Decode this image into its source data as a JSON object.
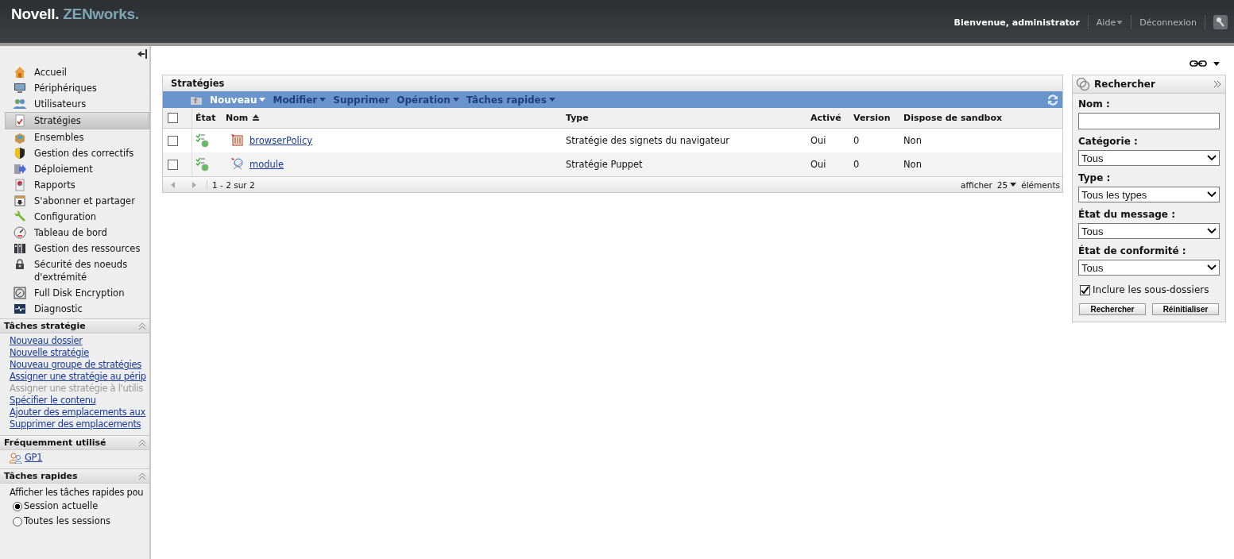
{
  "header": {
    "brand": "Novell.",
    "product": "ZENworks.",
    "welcome": "Bienvenue, administrator",
    "links": [
      {
        "label": "Aide",
        "dropdown": true
      },
      {
        "label": "Déconnexion",
        "dropdown": false
      }
    ]
  },
  "sidebar": {
    "nav": [
      {
        "label": "Accueil",
        "selected": false
      },
      {
        "label": "Périphériques",
        "selected": false
      },
      {
        "label": "Utilisateurs",
        "selected": false
      },
      {
        "label": "Stratégies",
        "selected": true
      },
      {
        "label": "Ensembles",
        "selected": false
      },
      {
        "label": "Gestion des correctifs",
        "selected": false
      },
      {
        "label": "Déploiement",
        "selected": false
      },
      {
        "label": "Rapports",
        "selected": false
      },
      {
        "label": "S'abonner et partager",
        "selected": false
      },
      {
        "label": "Configuration",
        "selected": false
      },
      {
        "label": "Tableau de bord",
        "selected": false
      },
      {
        "label": "Gestion des ressources",
        "selected": false
      },
      {
        "label": "Sécurité des noeuds d'extrémité",
        "selected": false
      },
      {
        "label": "Full Disk Encryption",
        "selected": false
      },
      {
        "label": "Diagnostic",
        "selected": false
      }
    ],
    "sections": [
      {
        "title": "Tâches stratégie",
        "kind": "links",
        "links": [
          {
            "label": "Nouveau dossier",
            "disabled": false
          },
          {
            "label": "Nouvelle stratégie",
            "disabled": false
          },
          {
            "label": "Nouveau groupe de stratégies",
            "disabled": false
          },
          {
            "label": "Assigner une stratégie au périp",
            "disabled": false
          },
          {
            "label": "Assigner une stratégie à l'utilis",
            "disabled": true
          },
          {
            "label": "Spécifier le contenu",
            "disabled": false
          },
          {
            "label": "Ajouter des emplacements aux",
            "disabled": false
          },
          {
            "label": "Supprimer des emplacements",
            "disabled": false
          }
        ]
      },
      {
        "title": "Fréquemment utilisé",
        "kind": "items",
        "links": [
          {
            "label": "GP1",
            "disabled": false
          }
        ]
      },
      {
        "title": "Tâches rapides",
        "kind": "options",
        "text": "Afficher les tâches rapides pou",
        "options": [
          {
            "label": "Session actuelle",
            "selected": true
          },
          {
            "label": "Toutes les sessions",
            "selected": false
          }
        ]
      }
    ]
  },
  "panel": {
    "title": "Stratégies",
    "toolbar": [
      {
        "label": "Nouveau",
        "dropdown": true,
        "primary": true
      },
      {
        "label": "Modifier",
        "dropdown": true,
        "primary": false
      },
      {
        "label": "Supprimer",
        "dropdown": false,
        "primary": false
      },
      {
        "label": "Opération",
        "dropdown": true,
        "primary": false
      },
      {
        "label": "Tâches rapides",
        "dropdown": true,
        "primary": false
      }
    ],
    "all_checked": false,
    "columns": [
      {
        "label": "État",
        "sorted": false
      },
      {
        "label": "Nom",
        "sorted": true
      },
      {
        "label": "Type",
        "sorted": false
      },
      {
        "label": "Activé",
        "sorted": false
      },
      {
        "label": "Version",
        "sorted": false
      },
      {
        "label": "Dispose de sandbox",
        "sorted": false
      }
    ],
    "rows": [
      {
        "checked": false,
        "name": "browserPolicy",
        "type": "Stratégie des signets du navigateur",
        "enabled": "Oui",
        "version": "0",
        "sandbox": "Non"
      },
      {
        "checked": false,
        "name": "module",
        "type": "Stratégie Puppet",
        "enabled": "Oui",
        "version": "0",
        "sandbox": "Non"
      }
    ],
    "footer": {
      "range": "1 - 2 sur 2",
      "show": "afficher",
      "page_size": "25",
      "items": "éléments"
    }
  },
  "search": {
    "title": "Rechercher",
    "fields": [
      {
        "label": "Nom :",
        "kind": "text"
      },
      {
        "label": "Catégorie :",
        "kind": "select",
        "value": "Tous"
      },
      {
        "label": "Type :",
        "kind": "select",
        "value": "Tous les types"
      },
      {
        "label": "État du message :",
        "kind": "select",
        "value": "Tous"
      },
      {
        "label": "État de conformité :",
        "kind": "select",
        "value": "Tous"
      }
    ],
    "include_subfolders": {
      "label": "Inclure les sous-dossiers",
      "checked": true
    },
    "buttons": [
      "Rechercher",
      "Réinitialiser"
    ]
  }
}
